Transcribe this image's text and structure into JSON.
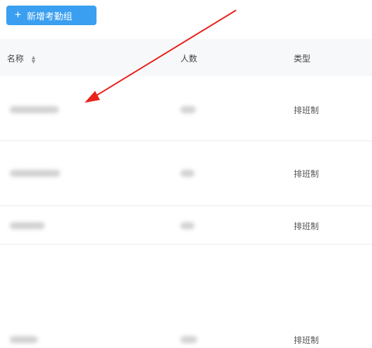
{
  "toolbar": {
    "add_button_label": "新增考勤组",
    "add_icon": "plus-icon"
  },
  "table": {
    "columns": [
      {
        "label": "名称",
        "sortable": true
      },
      {
        "label": "人数",
        "sortable": false
      },
      {
        "label": "类型",
        "sortable": false
      }
    ],
    "rows": [
      {
        "type": "排班制"
      },
      {
        "type": "排班制"
      },
      {
        "type": "排班制"
      },
      {
        "type": "排班制"
      }
    ]
  },
  "annotation": {
    "arrow_color": "#e8231c"
  },
  "colors": {
    "primary": "#3a9ff0",
    "header_bg": "#f7f8fa"
  }
}
